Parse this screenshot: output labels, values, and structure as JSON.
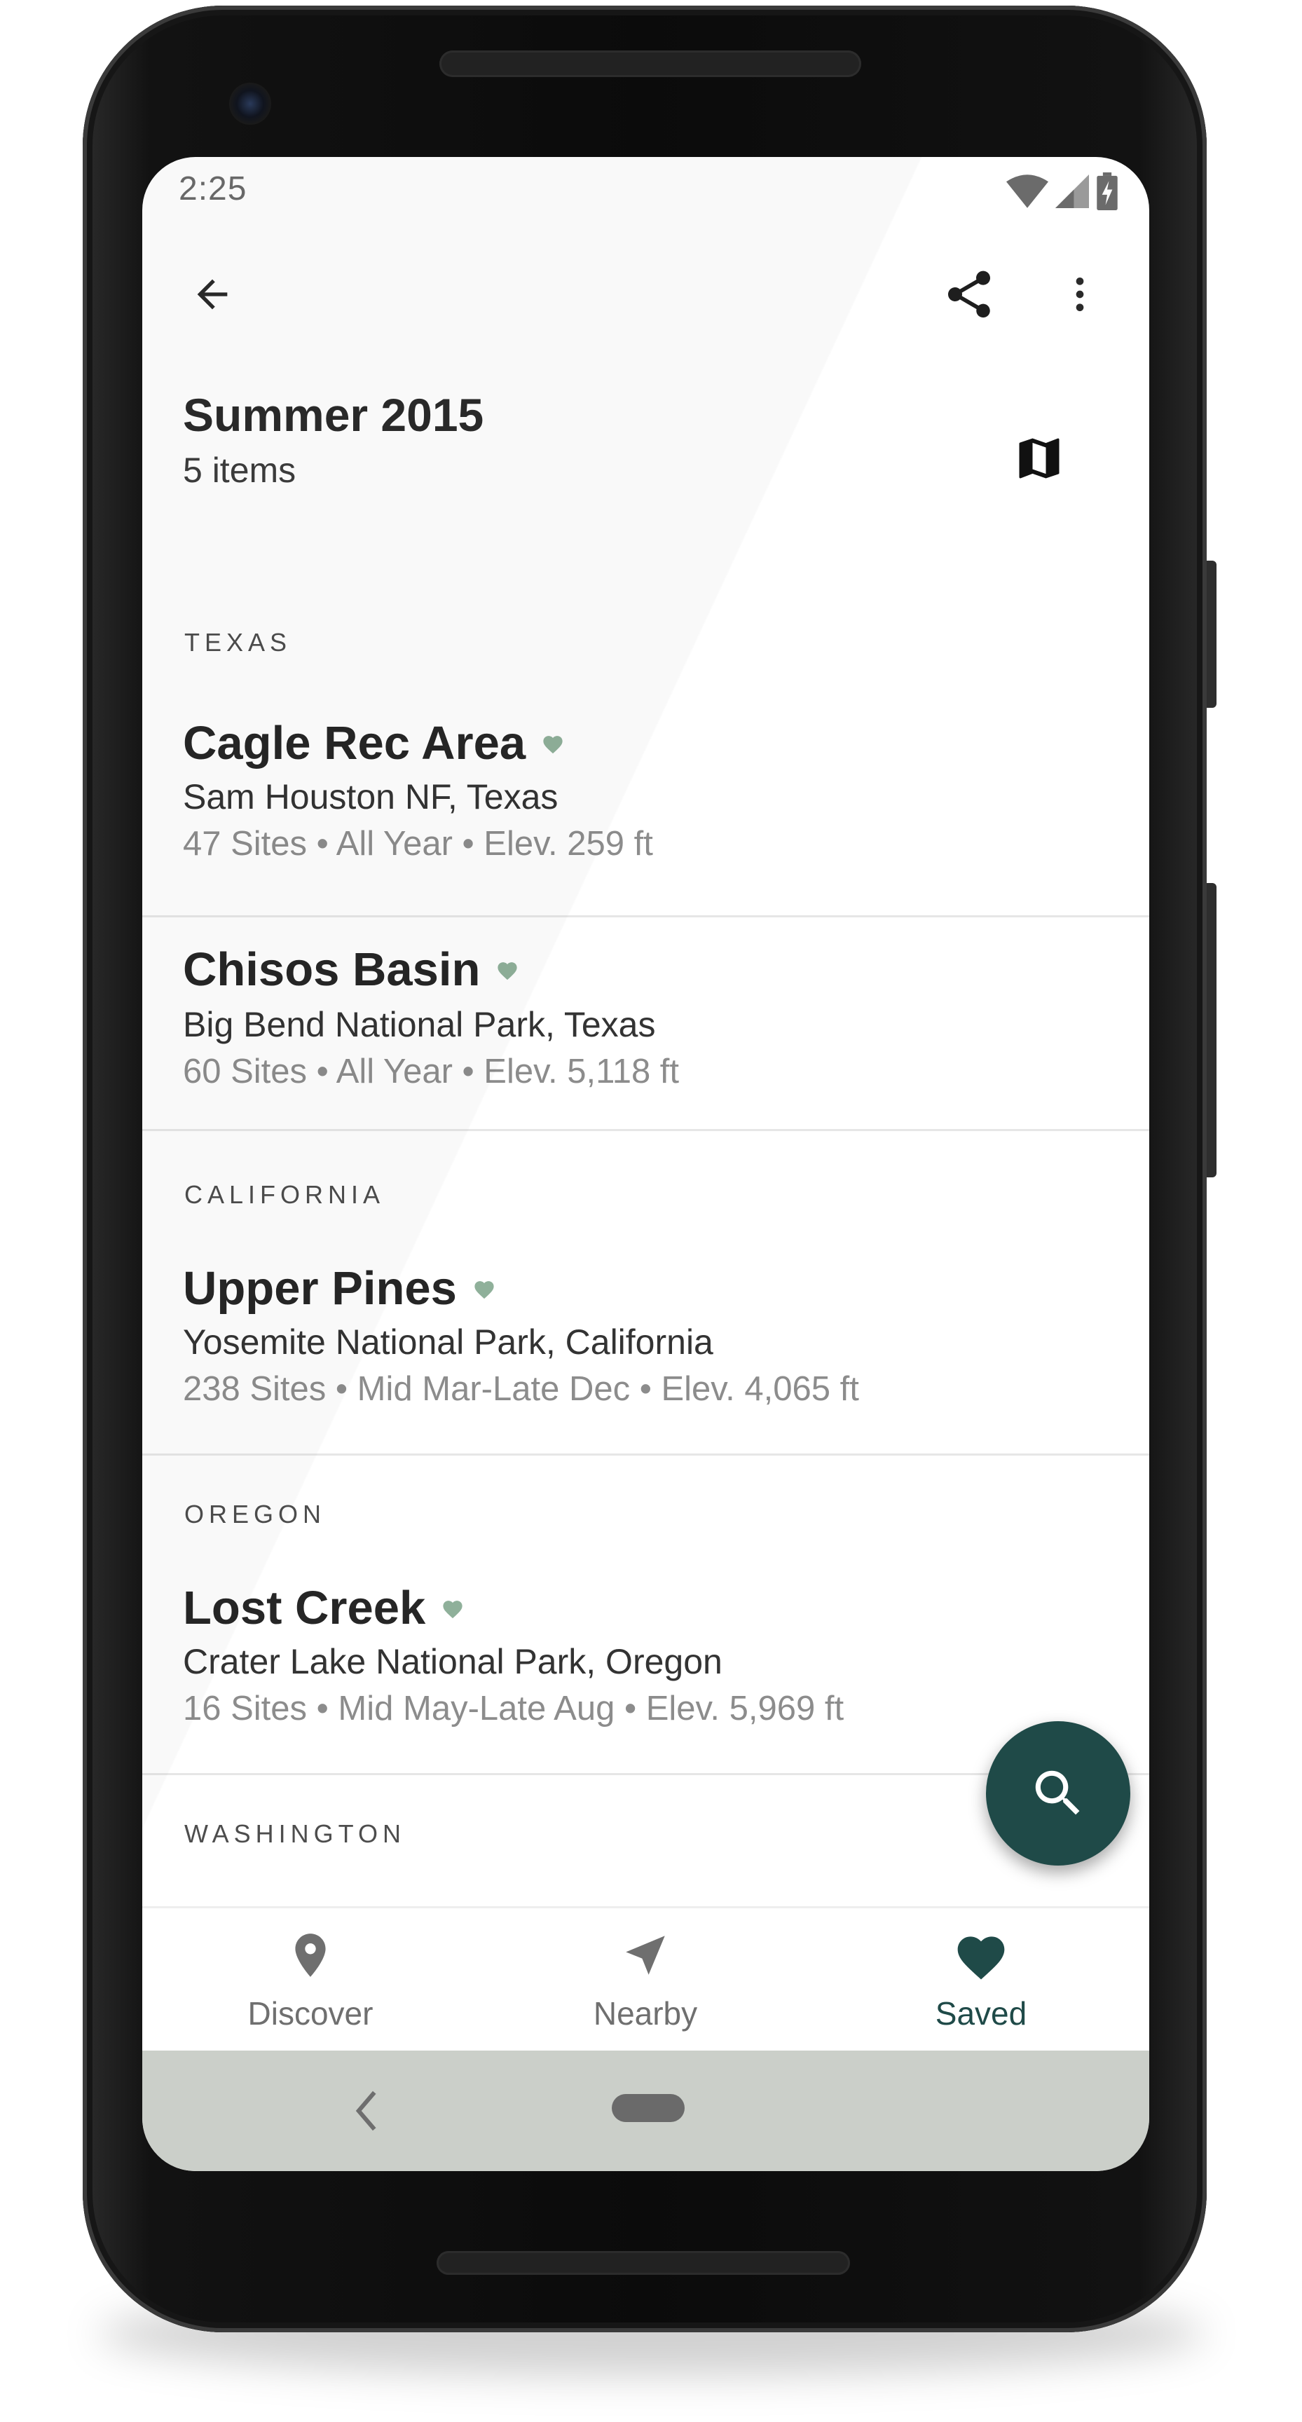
{
  "status_bar": {
    "time": "2:25"
  },
  "toolbar": {
    "back_icon": "arrow-back-icon",
    "share_icon": "share-icon",
    "more_icon": "more-vert-icon"
  },
  "header": {
    "title": "Summer 2015",
    "subtitle": "5 items",
    "map_icon": "map-icon"
  },
  "sections": [
    {
      "label": "TEXAS",
      "items": [
        {
          "name": "Cagle Rec Area",
          "park": "Sam Houston NF, Texas",
          "meta": "47 Sites • All Year • Elev. 259 ft"
        },
        {
          "name": "Chisos Basin",
          "park": "Big Bend National Park, Texas",
          "meta": "60 Sites • All Year • Elev. 5,118 ft"
        }
      ]
    },
    {
      "label": "CALIFORNIA",
      "items": [
        {
          "name": "Upper Pines",
          "park": "Yosemite National Park, California",
          "meta": "238 Sites • Mid Mar-Late Dec • Elev. 4,065 ft"
        }
      ]
    },
    {
      "label": "OREGON",
      "items": [
        {
          "name": "Lost Creek",
          "park": "Crater Lake National Park, Oregon",
          "meta": "16 Sites • Mid May-Late Aug • Elev. 5,969 ft"
        }
      ]
    },
    {
      "label": "WASHINGTON",
      "items": []
    }
  ],
  "fab": {
    "icon": "search-icon"
  },
  "bottom_nav": {
    "items": [
      {
        "label": "Discover",
        "icon": "place-icon",
        "active": false
      },
      {
        "label": "Nearby",
        "icon": "navigation-icon",
        "active": false
      },
      {
        "label": "Saved",
        "icon": "heart-icon",
        "active": true
      }
    ]
  },
  "colors": {
    "accent": "#1f4a48",
    "heart_small": "#8fb09a",
    "inactive_nav": "#6f6f6f",
    "system_nav": "#cbcfc9"
  }
}
